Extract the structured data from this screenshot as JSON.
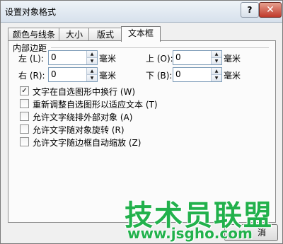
{
  "window": {
    "title": "设置对象格式",
    "help_glyph": "?",
    "close_glyph": "✕"
  },
  "tabs": [
    {
      "label": "颜色与线条",
      "active": false
    },
    {
      "label": "大小",
      "active": false
    },
    {
      "label": "版式",
      "active": false
    },
    {
      "label": "文本框",
      "active": true
    }
  ],
  "margins": {
    "group_label": "内部边距",
    "left_label": "左 (L):",
    "left_value": "0",
    "right_label": "右 (R):",
    "right_value": "0",
    "top_label": "上 (O):",
    "top_value": "0",
    "bottom_label": "下 (B):",
    "bottom_value": "0",
    "unit": "毫米"
  },
  "options": [
    {
      "label": "文字在自选图形中换行 (W)",
      "checked": true
    },
    {
      "label": "重新调整自选图形以适应文本 (T)",
      "checked": false
    },
    {
      "label": "允许文字绕排外部对象 (A)",
      "checked": false
    },
    {
      "label": "允许文字随对象旋转 (R)",
      "checked": false
    },
    {
      "label": "允许文字随边框自动缩放 (Z)",
      "checked": false
    }
  ],
  "buttons": {
    "cancel_label": "消"
  },
  "watermark": {
    "line1": "技术员联盟",
    "line2": "www.jsgho.com"
  }
}
